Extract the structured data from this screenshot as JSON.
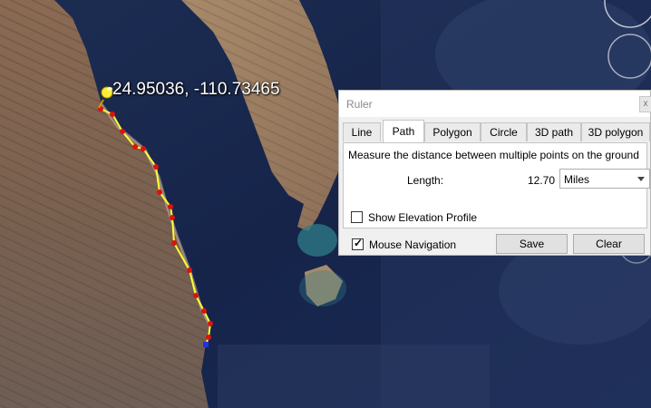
{
  "map": {
    "placemark_coordinates": "24.95036, -110.73465",
    "path_color": "#ffff33",
    "vertex_color": "#dd1111",
    "end_vertex_color": "#2233dd"
  },
  "ruler": {
    "title": "Ruler",
    "close_label": "x",
    "tabs": [
      "Line",
      "Path",
      "Polygon",
      "Circle",
      "3D path",
      "3D polygon"
    ],
    "active_tab": "Path",
    "description": "Measure the distance between multiple points on the ground",
    "length_label": "Length:",
    "length_value": "12.70",
    "unit_selected": "Miles",
    "show_elevation_label": "Show Elevation Profile",
    "show_elevation_checked": false,
    "mouse_nav_label": "Mouse Navigation",
    "mouse_nav_checked": true,
    "save_label": "Save",
    "clear_label": "Clear"
  }
}
